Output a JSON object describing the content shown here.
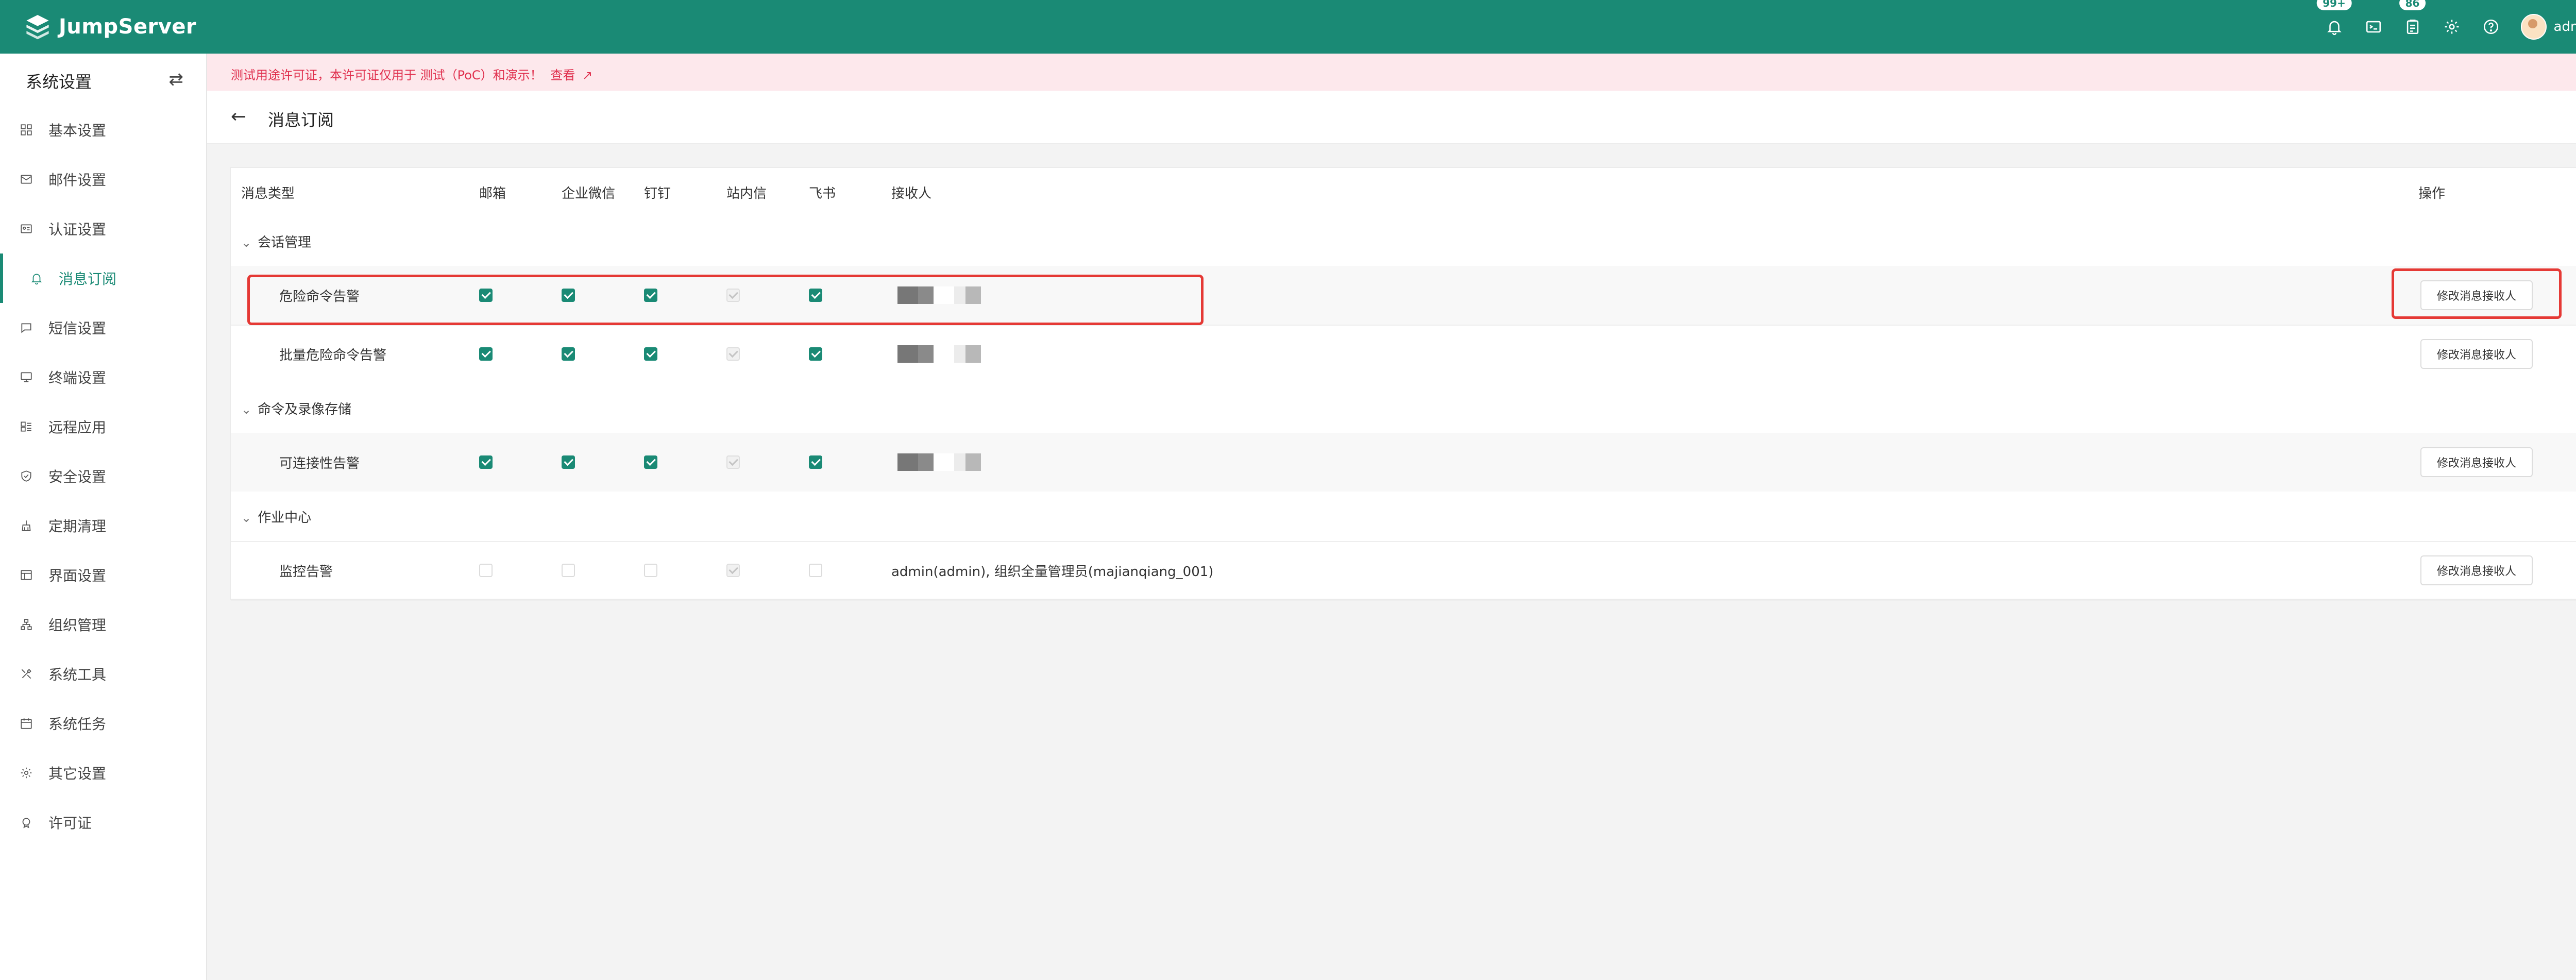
{
  "app": {
    "brand": "JumpServer"
  },
  "topbar": {
    "notification_badge": "99+",
    "ticket_badge": "86",
    "user": "admin"
  },
  "license": {
    "text": "测试用途许可证，本许可证仅用于 测试（PoC）和演示！",
    "link": "查看"
  },
  "page": {
    "title": "消息订阅"
  },
  "sidebar": {
    "title": "系统设置",
    "items": [
      {
        "label": "基本设置",
        "icon": "grid-icon"
      },
      {
        "label": "邮件设置",
        "icon": "mail-icon"
      },
      {
        "label": "认证设置",
        "icon": "id-card-icon"
      },
      {
        "label": "消息订阅",
        "icon": "bell-icon",
        "active": true
      },
      {
        "label": "短信设置",
        "icon": "chat-icon"
      },
      {
        "label": "终端设置",
        "icon": "monitor-icon"
      },
      {
        "label": "远程应用",
        "icon": "apps-icon"
      },
      {
        "label": "安全设置",
        "icon": "shield-icon"
      },
      {
        "label": "定期清理",
        "icon": "broom-icon"
      },
      {
        "label": "界面设置",
        "icon": "layout-icon"
      },
      {
        "label": "组织管理",
        "icon": "org-icon"
      },
      {
        "label": "系统工具",
        "icon": "tools-icon"
      },
      {
        "label": "系统任务",
        "icon": "calendar-icon"
      },
      {
        "label": "其它设置",
        "icon": "gear-icon"
      },
      {
        "label": "许可证",
        "icon": "license-icon"
      }
    ]
  },
  "table": {
    "headers": {
      "type": "消息类型",
      "email": "邮箱",
      "wecom": "企业微信",
      "dingtalk": "钉钉",
      "site_msg": "站内信",
      "feishu": "飞书",
      "receivers": "接收人",
      "action": "操作"
    },
    "action_label": "修改消息接收人",
    "groups": [
      {
        "name": "会话管理",
        "items": [
          {
            "name": "危险命令告警",
            "email": true,
            "wecom": true,
            "dingtalk": true,
            "site_msg": "disabled",
            "feishu": true,
            "receivers": "",
            "highlighted": true
          },
          {
            "name": "批量危险命令告警",
            "email": true,
            "wecom": true,
            "dingtalk": true,
            "site_msg": "disabled",
            "feishu": true,
            "receivers": ""
          }
        ]
      },
      {
        "name": "命令及录像存储",
        "items": [
          {
            "name": "可连接性告警",
            "email": true,
            "wecom": true,
            "dingtalk": true,
            "site_msg": "disabled",
            "feishu": true,
            "receivers": ""
          }
        ]
      },
      {
        "name": "作业中心",
        "items": [
          {
            "name": "监控告警",
            "email": false,
            "wecom": false,
            "dingtalk": false,
            "site_msg": "disabled",
            "feishu": false,
            "receivers": "admin(admin), 组织全量管理员(majianqiang_001)"
          }
        ]
      }
    ]
  },
  "colors": {
    "primary": "#1a8a75",
    "alert": "#e0304e",
    "highlight": "#e53935"
  }
}
